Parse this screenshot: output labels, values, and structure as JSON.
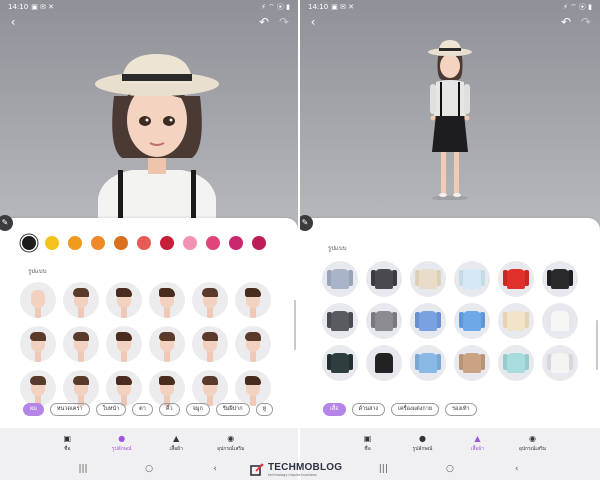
{
  "left_screen": {
    "status": {
      "time": "14:10",
      "left_icons": "▣ ✉ ✕",
      "right_icons": "⚡ ⌔ ⦿ ▮"
    },
    "toolbar": {
      "back_icon": "‹",
      "undo_icon": "↶",
      "redo_icon": "↷"
    },
    "colors": [
      "#1c1c1c",
      "#f4c21a",
      "#ee9a1c",
      "#ef8a2a",
      "#d8701d",
      "#e85a55",
      "#c71f3a",
      "#f492b6",
      "#e0447b",
      "#c8266e",
      "#bd1c59"
    ],
    "section_label": "รูปแบบ",
    "hair_styles": [
      {
        "style": "none"
      },
      {
        "style": "side"
      },
      {
        "style": "spike"
      },
      {
        "style": "spike"
      },
      {
        "style": "side"
      },
      {
        "style": "spike"
      },
      {
        "style": "side"
      },
      {
        "style": "side"
      },
      {
        "style": "spike"
      },
      {
        "style": "side"
      },
      {
        "style": "side"
      },
      {
        "style": "side"
      },
      {
        "style": "side"
      },
      {
        "style": "side"
      },
      {
        "style": "spike"
      },
      {
        "style": "spike"
      },
      {
        "style": "side"
      },
      {
        "style": "spike"
      }
    ],
    "chips": [
      {
        "label": "ผม",
        "active": true
      },
      {
        "label": "หนวดเครา",
        "active": false
      },
      {
        "label": "ใบหน้า",
        "active": false
      },
      {
        "label": "ตา",
        "active": false
      },
      {
        "label": "คิ้ว",
        "active": false
      },
      {
        "label": "จมูก",
        "active": false
      },
      {
        "label": "รีมฝีปาก",
        "active": false
      },
      {
        "label": "หู",
        "active": false
      }
    ],
    "tabs": [
      {
        "icon": "▣",
        "label": "ชื่อ",
        "active": false
      },
      {
        "icon": "●",
        "label": "รูปลักษณ์",
        "active": true
      },
      {
        "icon": "▲",
        "label": "เสื้อผ้า",
        "active": false
      },
      {
        "icon": "◉",
        "label": "อุปกรณ์เสริม",
        "active": false
      }
    ]
  },
  "right_screen": {
    "status": {
      "time": "14:10",
      "left_icons": "▣ ✉ ✕",
      "right_icons": "⚡ ⌔ ⦿ ▮"
    },
    "toolbar": {
      "back_icon": "‹",
      "undo_icon": "↶",
      "redo_icon": "↷"
    },
    "section_label": "รูปแบบ",
    "clothes": [
      {
        "color": "#aab4c8",
        "sleeve": "#9aa4b8"
      },
      {
        "color": "#4a4a4e",
        "sleeve": "#3c3c40"
      },
      {
        "color": "#e9ddc7",
        "sleeve": "#ddd0b8"
      },
      {
        "color": "#d6e8f4",
        "sleeve": "#c5dbe9"
      },
      {
        "color": "#e0302b",
        "sleeve": "#c92722"
      },
      {
        "color": "#2a2a2c",
        "sleeve": "#1f1f21"
      },
      {
        "color": "#5a5b60",
        "sleeve": "#4a4b50"
      },
      {
        "color": "#8c8c90",
        "sleeve": "#7a7a7e"
      },
      {
        "color": "#7aa2e0",
        "sleeve": "#6891d1"
      },
      {
        "color": "#6fa8e6",
        "sleeve": "#5d97d6"
      },
      {
        "color": "#f1e4c8",
        "sleeve": "#e4d4b4"
      },
      {
        "color": "#f6f6f6",
        "sleeve": "#e6e6e6"
      },
      {
        "color": "#2d3e3c",
        "sleeve": "#22312f"
      },
      {
        "color": "#222222",
        "sleeve": "#e7e9ee"
      },
      {
        "color": "#8ab9e6",
        "sleeve": "#79a8d6"
      },
      {
        "color": "#c9a383",
        "sleeve": "#b99375"
      },
      {
        "color": "#a9dcdc",
        "sleeve": "#98cbcb"
      },
      {
        "color": "#f4f4f4",
        "sleeve": "#d8d8d8"
      }
    ],
    "chips": [
      {
        "label": "เสื้อ",
        "active": true
      },
      {
        "label": "ด้านล่าง",
        "active": false
      },
      {
        "label": "เครื่องแต่งกาย",
        "active": false
      },
      {
        "label": "รองเท้า",
        "active": false
      }
    ],
    "tabs": [
      {
        "icon": "▣",
        "label": "ชื่อ",
        "active": false
      },
      {
        "icon": "●",
        "label": "รูปลักษณ์",
        "active": false
      },
      {
        "icon": "▲",
        "label": "เสื้อผ้า",
        "active": true
      },
      {
        "icon": "◉",
        "label": "อุปกรณ์เสริม",
        "active": false
      }
    ]
  },
  "navbar": {
    "recent_icon": "|||",
    "home_icon": "○",
    "back_icon": "‹"
  },
  "watermark": {
    "title": "TECHMOBLOG",
    "subtitle": "technology inspire business"
  },
  "accent_color": "#b485e6"
}
